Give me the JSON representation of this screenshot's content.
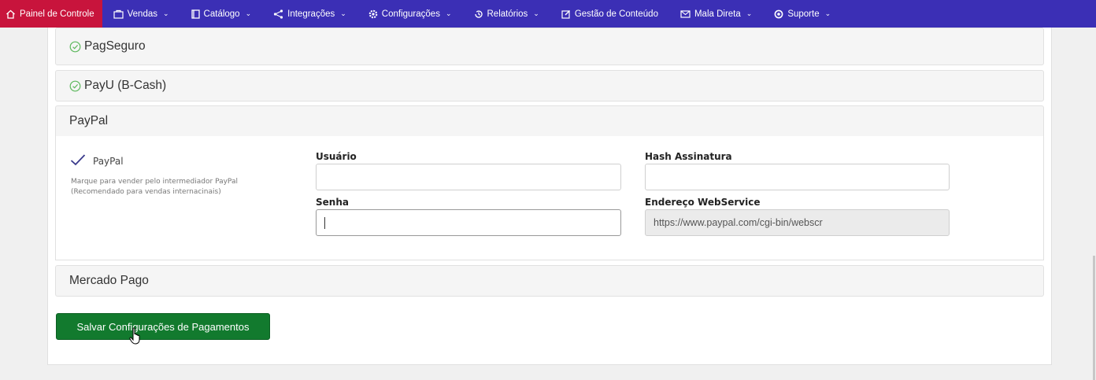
{
  "nav": {
    "items": [
      {
        "label": "Painel de Controle",
        "icon": "home-icon"
      },
      {
        "label": "Vendas",
        "icon": "briefcase-icon",
        "dropdown": true
      },
      {
        "label": "Catálogo",
        "icon": "book-icon",
        "dropdown": true
      },
      {
        "label": "Integrações",
        "icon": "share-icon",
        "dropdown": true
      },
      {
        "label": "Configurações",
        "icon": "gear-icon",
        "dropdown": true
      },
      {
        "label": "Relatórios",
        "icon": "history-icon",
        "dropdown": true
      },
      {
        "label": "Gestão de Conteúdo",
        "icon": "edit-icon"
      },
      {
        "label": "Mala Direta",
        "icon": "envelope-icon",
        "dropdown": true
      },
      {
        "label": "Suporte",
        "icon": "support-icon",
        "dropdown": true
      }
    ]
  },
  "accordions": {
    "pagseguro": {
      "title": "PagSeguro",
      "active": true
    },
    "payu": {
      "title": "PayU (B-Cash)",
      "active": true
    },
    "paypal": {
      "title": "PayPal"
    },
    "mercadopago": {
      "title": "Mercado Pago"
    }
  },
  "paypal": {
    "check_label": "PayPal",
    "desc_line1": "Marque para vender pelo intermediador PayPal",
    "desc_line2": "(Recomendado para vendas internacinais)",
    "usuario_label": "Usuário",
    "usuario_value": "",
    "senha_label": "Senha",
    "senha_value": "",
    "hash_label": "Hash Assinatura",
    "hash_value": "",
    "endereco_label": "Endereço WebService",
    "endereco_value": "https://www.paypal.com/cgi-bin/webscr"
  },
  "save_button": "Salvar Configurações de Pagamentos",
  "colors": {
    "navbar": "#3b2fb5",
    "nav_active": "#c8143c",
    "save_button": "#127a2e",
    "check_green": "#5cb85c"
  }
}
